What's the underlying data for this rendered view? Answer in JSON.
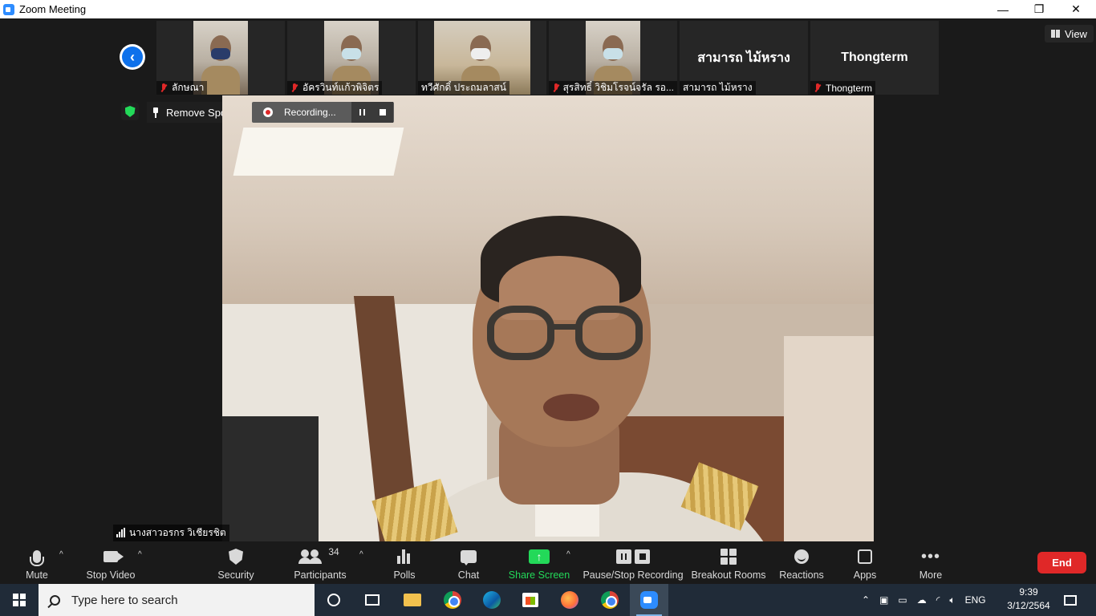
{
  "window": {
    "title": "Zoom Meeting",
    "minimize": "—",
    "restore": "❐",
    "close": "✕"
  },
  "gallery": {
    "participants": [
      {
        "name": "ลักษณา",
        "muted": true,
        "has_video": true
      },
      {
        "name": "อัครวินท์แก้วพิจิตร",
        "muted": true,
        "has_video": true
      },
      {
        "name": "ทวีศักดิ์ ประถมลาสน์",
        "muted": false,
        "has_video": true
      },
      {
        "name": "สุรสิทธิ์ วิชิมโรจน์จรัล รอ...",
        "muted": true,
        "has_video": true
      },
      {
        "name": "สามารถ ไม้หราง",
        "display_text": "สามารถ ไม้หราง",
        "muted": false,
        "has_video": false
      },
      {
        "name": "Thongterm",
        "display_text": "Thongterm",
        "muted": true,
        "has_video": false
      }
    ],
    "view_label": "View"
  },
  "overlay": {
    "remove_spotlight": "Remove Spotlight",
    "recording_status": "Recording...",
    "encryption": "green-shield-icon"
  },
  "main_speaker": {
    "name": "นางสาวอรกร วิเชียรชิต"
  },
  "toolbar": {
    "mute": "Mute",
    "stop_video": "Stop Video",
    "security": "Security",
    "participants": "Participants",
    "participant_count": "34",
    "polls": "Polls",
    "chat": "Chat",
    "share_screen": "Share Screen",
    "pause_stop_recording": "Pause/Stop Recording",
    "breakout_rooms": "Breakout Rooms",
    "reactions": "Reactions",
    "apps": "Apps",
    "more": "More",
    "end": "End"
  },
  "colors": {
    "accent_green": "#23d959",
    "end_red": "#e02828",
    "zoom_blue": "#0e71eb",
    "mute_red": "#e02828"
  },
  "taskbar": {
    "search_placeholder": "Type here to search",
    "language": "ENG",
    "time": "9:39",
    "date": "3/12/2564"
  }
}
